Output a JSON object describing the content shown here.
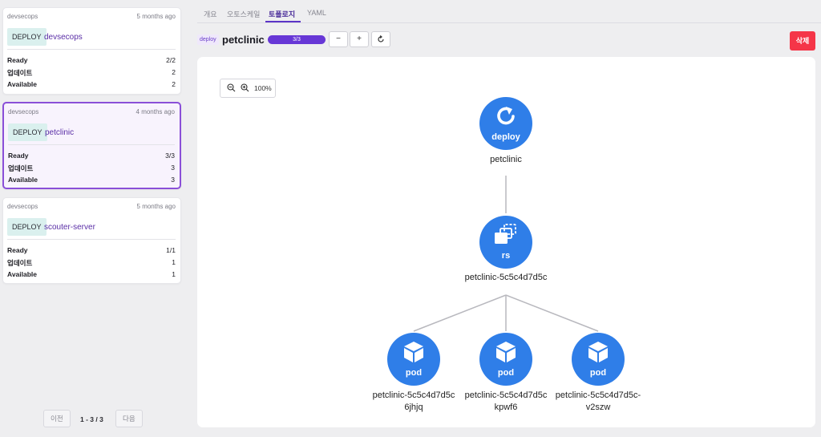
{
  "deployments": [
    {
      "namespace": "devsecops",
      "age": "5 months ago",
      "kind": "DEPLOY",
      "name": "devsecops",
      "stats": [
        {
          "label": "Ready",
          "value": "2/2"
        },
        {
          "label": "업데이트",
          "value": "2"
        },
        {
          "label": "Available",
          "value": "2"
        }
      ]
    },
    {
      "namespace": "devsecops",
      "age": "4 months ago",
      "kind": "DEPLOY",
      "name": "petclinic",
      "stats": [
        {
          "label": "Ready",
          "value": "3/3"
        },
        {
          "label": "업데이트",
          "value": "3"
        },
        {
          "label": "Available",
          "value": "3"
        }
      ]
    },
    {
      "namespace": "devsecops",
      "age": "5 months ago",
      "kind": "DEPLOY",
      "name": "scouter-server",
      "stats": [
        {
          "label": "Ready",
          "value": "1/1"
        },
        {
          "label": "업데이트",
          "value": "1"
        },
        {
          "label": "Available",
          "value": "1"
        }
      ]
    }
  ],
  "pager": {
    "prev": "이전",
    "info": "1 - 3 / 3",
    "next": "다음"
  },
  "tabs": [
    {
      "label": "개요"
    },
    {
      "label": "오토스케일"
    },
    {
      "label": "토폴로지"
    },
    {
      "label": "YAML"
    }
  ],
  "active_tab": "토폴로지",
  "header": {
    "kind_chip": "deploy",
    "title": "petclinic",
    "ready": "3/3",
    "ready_fraction": 1.0,
    "scale_down": "−",
    "scale_up": "+",
    "delete_label": "삭제"
  },
  "topology": {
    "zoom": "100%",
    "deploy_node": {
      "kind": "deploy",
      "name": "petclinic"
    },
    "rs_node": {
      "kind": "rs",
      "name": "petclinic-5c5c4d7d5c"
    },
    "pods": [
      {
        "kind": "pod",
        "name_line1": "petclinic-5c5c4d7d5c",
        "name_line2": "6jhjq"
      },
      {
        "kind": "pod",
        "name_line1": "petclinic-5c5c4d7d5c",
        "name_line2": "kpwf6"
      },
      {
        "kind": "pod",
        "name_line1": "petclinic-5c5c4d7d5c-",
        "name_line2": "v2szw"
      }
    ]
  },
  "colors": {
    "accent": "#6737d6",
    "node": "#2f7ee8",
    "delete": "#f53548",
    "deploy_tag": "#daf0ee"
  }
}
